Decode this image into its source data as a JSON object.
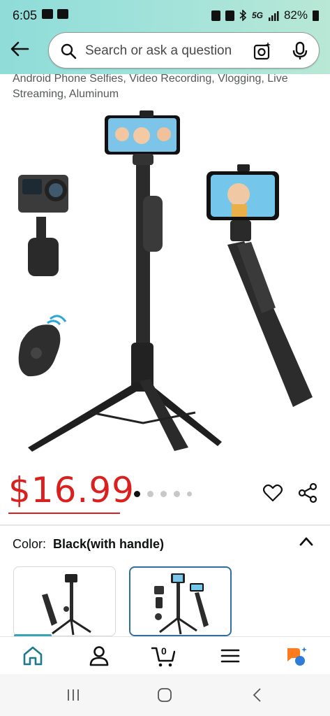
{
  "status_bar": {
    "time": "6:05",
    "left_icons": [
      "image-icon",
      "mail-icon"
    ],
    "network": "5G",
    "battery": "82%",
    "right_icons": [
      "lock-icon",
      "nfc-icon",
      "bluetooth-icon",
      "signal-icon",
      "battery-icon"
    ]
  },
  "header": {
    "search_placeholder": "Search or ask a question"
  },
  "product": {
    "title_fragment": "Android Phone Selfies, Video Recording, Vlogging, Live Streaming, Aluminum",
    "price": "$16.99",
    "image_count": 5,
    "active_image_index": 0
  },
  "variation": {
    "label": "Color:",
    "selected": "Black(with handle)",
    "options_shown": 2,
    "selected_option_index": 1
  },
  "bottom_nav": {
    "items": [
      "home-icon",
      "account-icon",
      "cart-icon",
      "menu-icon",
      "rufus-ai-icon"
    ],
    "cart_count": "0"
  },
  "colors": {
    "header_gradient_start": "#8fdcd9",
    "header_gradient_end": "#b9e8d5",
    "price": "#d9201f",
    "selected_border": "#2f6fa0",
    "accent_teal": "#3aa3b8"
  }
}
